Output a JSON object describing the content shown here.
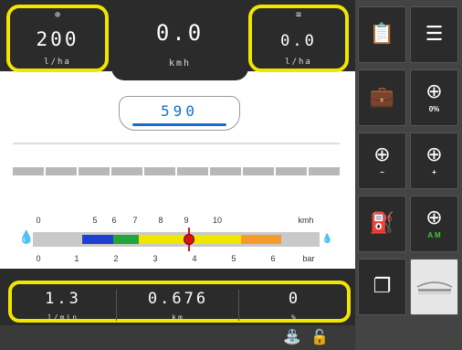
{
  "app_rate": {
    "icon": "crosshair-icon",
    "value": "200",
    "unit": "l/ha"
  },
  "speed": {
    "value": "0.0",
    "unit": "kmh"
  },
  "actual_rate": {
    "icon": "flow-icon",
    "value": "0.0",
    "unit": "l/ha"
  },
  "tank": {
    "volume": "590"
  },
  "boom": {
    "section_count": 10
  },
  "speed_scale": {
    "ticks": [
      "0",
      "5",
      "6",
      "7",
      "8",
      "9",
      "10"
    ],
    "unit": "kmh"
  },
  "pressure_scale": {
    "ticks": [
      "0",
      "1",
      "2",
      "3",
      "4",
      "5",
      "6"
    ],
    "unit": "bar"
  },
  "pressure_bands": [
    {
      "color": "#1f3fd0"
    },
    {
      "color": "#22a53a"
    },
    {
      "color": "#f0e600"
    },
    {
      "color": "#f59b2b"
    }
  ],
  "flow": {
    "value": "1.3",
    "unit": "l/min"
  },
  "area": {
    "value": "0.676",
    "unit": "km"
  },
  "coverage": {
    "value": "0",
    "unit": "%"
  },
  "panel": {
    "btn_clipboard": {
      "icon": "clipboard-icon"
    },
    "btn_menu": {
      "icon": "menu-icon"
    },
    "btn_briefcase": {
      "icon": "briefcase-icon"
    },
    "btn_nozzle_pct": {
      "icon": "nozzle-icon",
      "label": "0%"
    },
    "btn_nozzle_minus": {
      "icon": "nozzle-icon",
      "label": "−"
    },
    "btn_nozzle_plus": {
      "icon": "nozzle-icon",
      "label": "+"
    },
    "btn_tank_fill": {
      "icon": "tank-fill-icon"
    },
    "btn_nozzle_auto": {
      "icon": "nozzle-icon",
      "label": "A M"
    },
    "btn_copy": {
      "icon": "copy-icon"
    },
    "btn_boom": {
      "icon": "boom-icon"
    }
  },
  "colors": {
    "highlight": "#f2e600",
    "accent": "#1a6bd1",
    "needle": "#dd1111"
  }
}
